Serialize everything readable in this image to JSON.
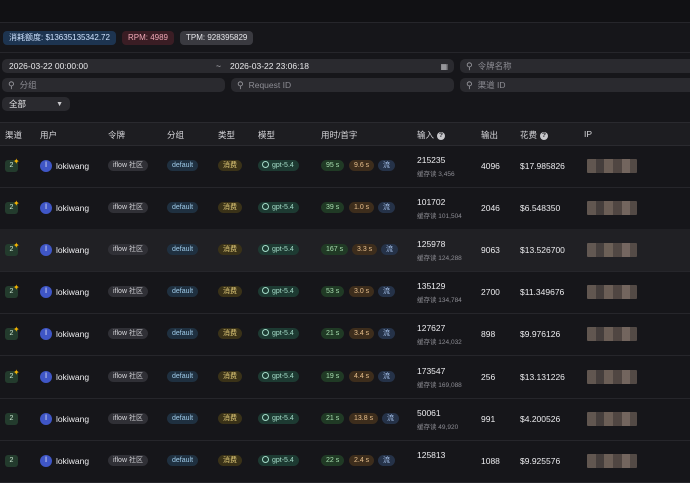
{
  "stats": {
    "quota": "消耗额度: $13635135342.72",
    "rpm": "RPM: 4989",
    "tpm": "TPM: 928395829"
  },
  "filters": {
    "start_time": "2026-03-22 00:00:00",
    "range_sep": "~",
    "end_time": "2026-03-22 23:06:18",
    "token_name_placeholder": "令牌名称",
    "group_placeholder": "分组",
    "request_id_placeholder": "Request ID",
    "channel_id_placeholder": "渠道 ID",
    "log_type": "全部"
  },
  "table": {
    "headers": {
      "channel": "渠道",
      "user": "用户",
      "token": "令牌",
      "group": "分组",
      "type": "类型",
      "model": "模型",
      "timing": "用时/首字",
      "input": "输入",
      "output": "输出",
      "cost": "花费",
      "ip": "IP"
    },
    "rows": [
      {
        "channel": "2",
        "user_initial": "l",
        "user": "lokiwang",
        "token": "iflow 社区",
        "group": "default",
        "type": "消费",
        "model": "gpt-5.4",
        "time": "95 s",
        "first": "9.6 s",
        "stream": "流",
        "input": "215235",
        "cache": "缓存读 3,456",
        "output": "4096",
        "cost": "$17.985826"
      },
      {
        "channel": "2",
        "user_initial": "l",
        "user": "lokiwang",
        "token": "iflow 社区",
        "group": "default",
        "type": "消费",
        "model": "gpt-5.4",
        "time": "39 s",
        "first": "1.0 s",
        "stream": "流",
        "input": "101702",
        "cache": "缓存读 101,504",
        "output": "2046",
        "cost": "$6.548350"
      },
      {
        "channel": "2",
        "user_initial": "l",
        "user": "lokiwang",
        "token": "iflow 社区",
        "group": "default",
        "type": "消费",
        "model": "gpt-5.4",
        "time": "167 s",
        "first": "3.3 s",
        "stream": "流",
        "input": "125978",
        "cache": "缓存读 124,288",
        "output": "9063",
        "cost": "$13.526700"
      },
      {
        "channel": "2",
        "user_initial": "l",
        "user": "lokiwang",
        "token": "iflow 社区",
        "group": "default",
        "type": "消费",
        "model": "gpt-5.4",
        "time": "53 s",
        "first": "3.0 s",
        "stream": "流",
        "input": "135129",
        "cache": "缓存读 134,784",
        "output": "2700",
        "cost": "$11.349676"
      },
      {
        "channel": "2",
        "user_initial": "l",
        "user": "lokiwang",
        "token": "iflow 社区",
        "group": "default",
        "type": "消费",
        "model": "gpt-5.4",
        "time": "21 s",
        "first": "3.4 s",
        "stream": "流",
        "input": "127627",
        "cache": "缓存读 124,032",
        "output": "898",
        "cost": "$9.976126"
      },
      {
        "channel": "2",
        "user_initial": "l",
        "user": "lokiwang",
        "token": "iflow 社区",
        "group": "default",
        "type": "消费",
        "model": "gpt-5.4",
        "time": "19 s",
        "first": "4.4 s",
        "stream": "流",
        "input": "173547",
        "cache": "缓存读 169,088",
        "output": "256",
        "cost": "$13.131226"
      },
      {
        "channel": "2",
        "user_initial": "l",
        "user": "lokiwang",
        "token": "iflow 社区",
        "group": "default",
        "type": "消费",
        "model": "gpt-5.4",
        "time": "21 s",
        "first": "13.8 s",
        "stream": "流",
        "input": "50061",
        "cache": "缓存读 49,920",
        "output": "991",
        "cost": "$4.200526"
      },
      {
        "channel": "2",
        "user_initial": "l",
        "user": "lokiwang",
        "token": "iflow 社区",
        "group": "default",
        "type": "消费",
        "model": "gpt-5.4",
        "time": "22 s",
        "first": "2.4 s",
        "stream": "流",
        "input": "125813",
        "cache": "",
        "output": "1088",
        "cost": "$9.925576"
      }
    ]
  }
}
